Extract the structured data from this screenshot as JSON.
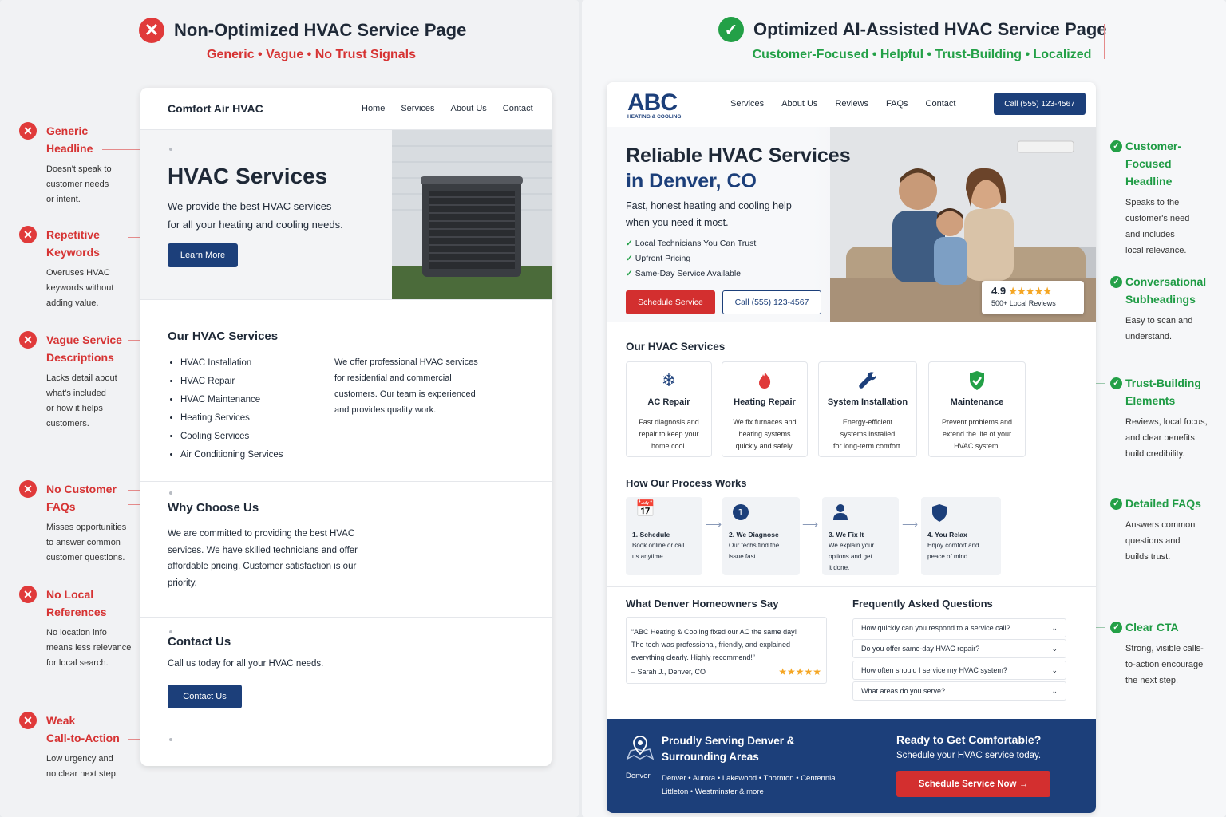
{
  "left": {
    "title": "Non-Optimized HVAC Service Page",
    "subtitle": "Generic • Vague • No Trust Signals",
    "annotations": [
      {
        "h1": "Generic",
        "h2": "Headline",
        "d": [
          "Doesn't speak to",
          "customer needs",
          "or intent."
        ]
      },
      {
        "h1": "Repetitive",
        "h2": "Keywords",
        "d": [
          "Overuses HVAC",
          "keywords without",
          "adding value."
        ]
      },
      {
        "h1": "Vague Service",
        "h2": "Descriptions",
        "d": [
          "Lacks detail about",
          "what's included",
          "or how it helps",
          "customers."
        ]
      },
      {
        "h1": "No Customer",
        "h2": "FAQs",
        "d": [
          "Misses opportunities",
          "to answer common",
          "customer questions."
        ]
      },
      {
        "h1": "No Local",
        "h2": "References",
        "d": [
          "No location info",
          "means less relevance",
          "for local search."
        ]
      },
      {
        "h1": "Weak",
        "h2": "Call-to-Action",
        "d": [
          "Low urgency and",
          "no clear next step."
        ]
      }
    ],
    "page": {
      "brand": "Comfort Air HVAC",
      "nav": [
        "Home",
        "Services",
        "About Us",
        "Contact"
      ],
      "hero_title": "HVAC Services",
      "hero_text": [
        "We provide the best HVAC services",
        "for all your heating and cooling needs."
      ],
      "hero_button": "Learn More",
      "services_title": "Our HVAC Services",
      "services": [
        "HVAC Installation",
        "HVAC Repair",
        "HVAC Maintenance",
        "Heating Services",
        "Cooling Services",
        "Air Conditioning Services"
      ],
      "services_text": [
        "We offer professional HVAC services",
        "for residential and commercial",
        "customers. Our team is experienced",
        "and provides quality work."
      ],
      "why_title": "Why Choose Us",
      "why_text": [
        "We are committed to providing the best HVAC",
        "services. We have skilled technicians and offer",
        "affordable pricing. Customer satisfaction is our",
        "priority."
      ],
      "contact_title": "Contact Us",
      "contact_text": "Call us today for all your HVAC needs.",
      "contact_button": "Contact Us"
    }
  },
  "right": {
    "title": "Optimized AI-Assisted HVAC Service Page",
    "subtitle": "Customer-Focused • Helpful • Trust-Building • Localized",
    "annotations": [
      {
        "h1": "Customer-Focused",
        "h2": "Headline",
        "d": [
          "Speaks to the",
          "customer's need",
          "and includes",
          "local relevance."
        ]
      },
      {
        "h1": "Conversational",
        "h2": "Subheadings",
        "d": [
          "Easy to scan and",
          "understand."
        ]
      },
      {
        "h1": "Trust-Building",
        "h2": "Elements",
        "d": [
          "Reviews, local focus,",
          "and clear benefits",
          "build credibility."
        ]
      },
      {
        "h1": "Detailed FAQs",
        "h2": "",
        "d": [
          "Answers common",
          "questions and",
          "builds trust."
        ]
      },
      {
        "h1": "Clear CTA",
        "h2": "",
        "d": [
          "Strong, visible calls-",
          "to-action encourage",
          "the next step."
        ]
      }
    ],
    "page": {
      "logo": "ABC",
      "logo_sub": "HEATING & COOLING",
      "nav": [
        "Services",
        "About Us",
        "Reviews",
        "FAQs",
        "Contact"
      ],
      "call_button": "Call (555) 123-4567",
      "hero_title_1": "Reliable HVAC Services",
      "hero_title_2": "in Denver, CO",
      "hero_text": [
        "Fast, honest heating and cooling help",
        "when you need it most."
      ],
      "checks": [
        "Local Technicians You Can Trust",
        "Upfront Pricing",
        "Same-Day Service Available"
      ],
      "schedule_button": "Schedule Service",
      "call_outline": "Call (555) 123-4567",
      "rating": "4.9",
      "stars": "★★★★★",
      "reviews_count": "500+ Local Reviews",
      "services_title": "Our HVAC Services",
      "services": [
        {
          "t": "AC Repair",
          "s": [
            "Fast diagnosis and",
            "repair to keep your",
            "home cool."
          ]
        },
        {
          "t": "Heating Repair",
          "s": [
            "We fix furnaces and",
            "heating systems",
            "quickly and safely."
          ]
        },
        {
          "t": "System Installation",
          "s": [
            "Energy-efficient",
            "systems installed",
            "for long-term comfort."
          ]
        },
        {
          "t": "Maintenance",
          "s": [
            "Prevent problems and",
            "extend the life of your",
            "HVAC system."
          ]
        }
      ],
      "process_title": "How Our Process Works",
      "process": [
        {
          "t": "1. Schedule",
          "s": [
            "Book online or call",
            "us anytime."
          ]
        },
        {
          "t": "2. We Diagnose",
          "s": [
            "Our techs find the",
            "issue fast."
          ]
        },
        {
          "t": "3. We Fix It",
          "s": [
            "We explain your",
            "options and get",
            "it done."
          ]
        },
        {
          "t": "4. You Relax",
          "s": [
            "Enjoy comfort and",
            "peace of mind."
          ]
        }
      ],
      "testimonial_title": "What Denver Homeowners Say",
      "testimonial": [
        "“ABC Heating & Cooling fixed our AC the same day!",
        "The tech was professional, friendly, and explained",
        "everything clearly. Highly recommend!”"
      ],
      "testimonial_author": "– Sarah J., Denver, CO",
      "faq_title": "Frequently Asked Questions",
      "faqs": [
        "How quickly can you respond to a service call?",
        "Do you offer same-day HVAC repair?",
        "How often should I service my HVAC system?",
        "What areas do you serve?"
      ],
      "footer_title_1": "Proudly Serving Denver &",
      "footer_title_2": "Surrounding Areas",
      "footer_pin_label": "Denver",
      "footer_areas_1": "Denver • Aurora • Lakewood • Thornton • Centennial",
      "footer_areas_2": "Littleton • Westminster & more",
      "cta_title": "Ready to Get Comfortable?",
      "cta_text": "Schedule your HVAC service today.",
      "cta_button": "Schedule Service Now →"
    }
  },
  "colors": {
    "red": "#e03a3a",
    "green": "#23a047",
    "navy": "#1c3f7a",
    "cta_red": "#d32f2f"
  }
}
